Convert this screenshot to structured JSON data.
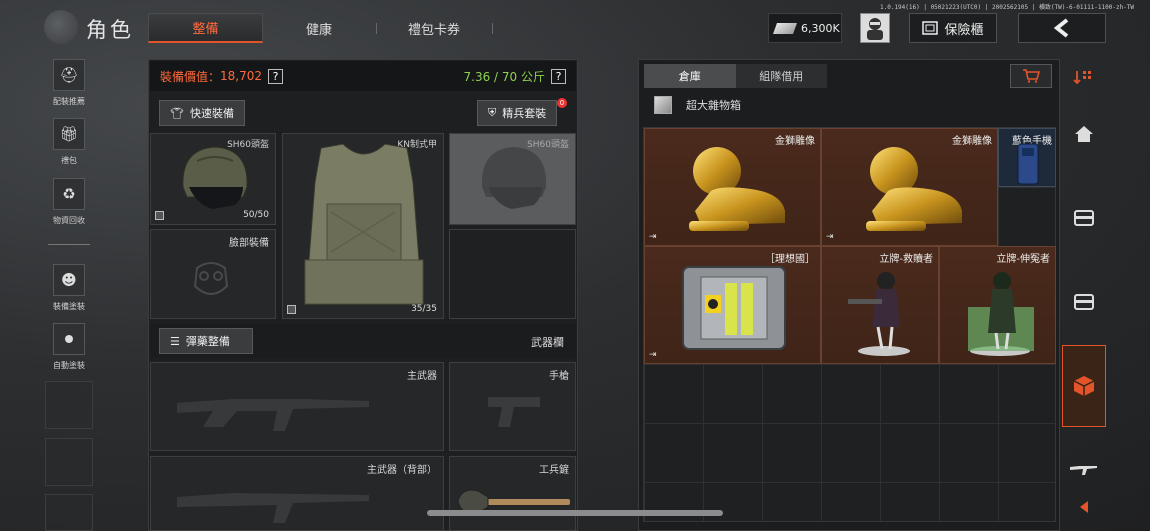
{
  "version_text": "1.0.194(16) | 05021223(UTC0) | 2002562105 | 横致(TW)-6-01111-1100-zh-TW",
  "header": {
    "title": "角色",
    "tabs": [
      {
        "label": "整備",
        "active": true
      },
      {
        "label": "健康",
        "active": false
      },
      {
        "label": "禮包卡券",
        "active": false
      }
    ],
    "currency_value": "6,300K",
    "safe_label": "保險櫃",
    "back_icon": "chevron-left-icon"
  },
  "sidebar": {
    "items": [
      {
        "label": "配裝推薦",
        "icon": "helmet-gear-icon"
      },
      {
        "label": "禮包",
        "icon": "gift-icon"
      },
      {
        "label": "物資回收",
        "icon": "recycle-icon"
      },
      {
        "label": "裝備塗裝",
        "icon": "paint-mask-icon"
      },
      {
        "label": "自動塗裝",
        "icon": "toggle-icon"
      }
    ]
  },
  "loadout": {
    "value_label": "裝備價值：",
    "value_amount": "18,702",
    "weight_text": "7.36 / 70 公斤",
    "help_glyph": "?",
    "quick_equip_label": "快速裝備",
    "elite_set_label": "精兵套裝",
    "elite_badge": "0",
    "slots": {
      "helmet": {
        "label": "SH60頭盔",
        "durability": "50/50"
      },
      "armor": {
        "label": "KN制式甲",
        "durability": "35/35"
      },
      "helmet_alt": {
        "label": "SH60頭盔"
      },
      "face": {
        "label": "臉部裝備"
      },
      "ammo_button": "彈藥整備",
      "weapon_bar": "武器欄",
      "primary": {
        "label": "主武器"
      },
      "pistol": {
        "label": "手槍"
      },
      "primary_back": {
        "label": "主武器（背部）"
      },
      "tool": {
        "label": "工兵鏟"
      }
    }
  },
  "stash": {
    "tabs": [
      {
        "label": "倉庫",
        "active": true
      },
      {
        "label": "組隊借用",
        "active": false
      }
    ],
    "category": "超大雜物箱",
    "items": [
      {
        "label": "金獅雕像",
        "color": "#4a2a1c"
      },
      {
        "label": "金獅雕像",
        "color": "#4a2a1c"
      },
      {
        "label": "藍色手機",
        "color": "#1e2a3a"
      },
      {
        "label": "［理想國］",
        "color": "#4a2a1c"
      },
      {
        "label": "立牌-救贖者",
        "color": "#4a2a1c"
      },
      {
        "label": "立牌-伸冤者",
        "color": "#4a2a1c"
      }
    ]
  },
  "colors": {
    "accent": "#e3542a",
    "value_text": "#ff6a3c",
    "weight_text": "#8fd14f"
  }
}
